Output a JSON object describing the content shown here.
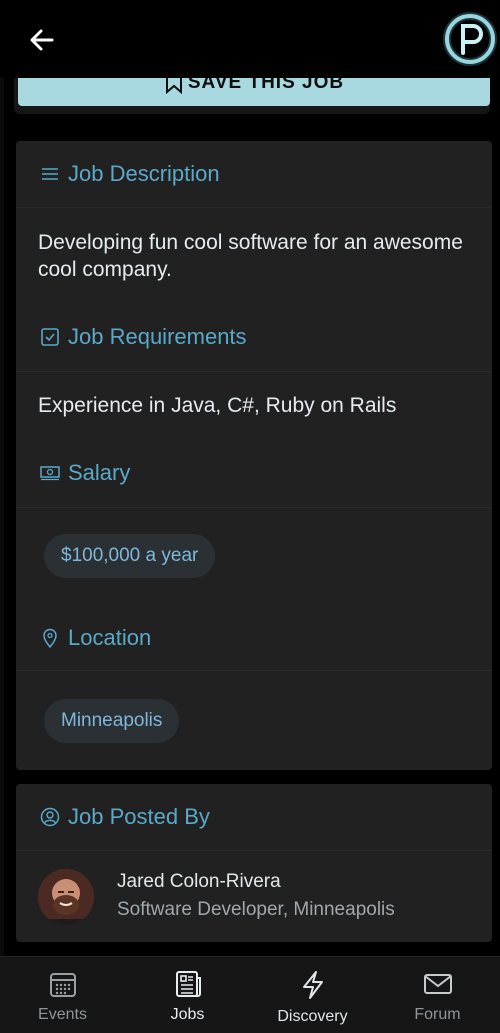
{
  "save_job": {
    "label": "SAVE THIS JOB",
    "icon": "bookmark-icon"
  },
  "sections": {
    "description": {
      "title": "Job Description",
      "text": "Developing fun cool software for an awesome cool company."
    },
    "requirements": {
      "title": "Job Requirements",
      "text": "Experience in Java, C#, Ruby on Rails"
    },
    "salary": {
      "title": "Salary",
      "chip": "$100,000 a year"
    },
    "location": {
      "title": "Location",
      "chip": "Minneapolis"
    }
  },
  "posted_by": {
    "title": "Job Posted By",
    "name": "Jared Colon-Rivera",
    "role": "Software Developer, Minneapolis"
  },
  "tabs": [
    {
      "label": "Events",
      "icon": "calendar-icon",
      "active": false
    },
    {
      "label": "Jobs",
      "icon": "newspaper-icon",
      "active": true
    },
    {
      "label": "Discovery",
      "icon": "lightning-icon",
      "active": false
    },
    {
      "label": "Forum",
      "icon": "mail-icon",
      "active": false
    }
  ],
  "colors": {
    "accent": "#5aa9c9",
    "save_button": "#a8d8e0",
    "card": "#212121",
    "chip": "#2b3035"
  }
}
